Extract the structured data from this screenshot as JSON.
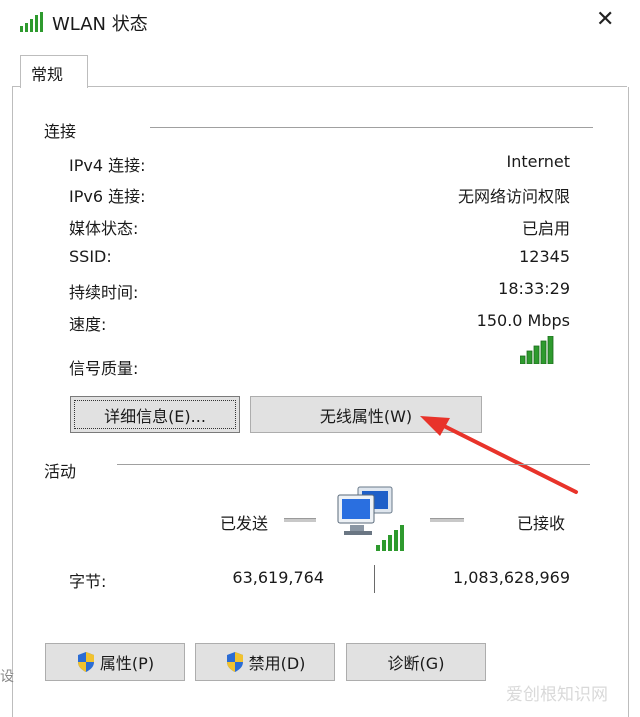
{
  "window": {
    "title": "WLAN 状态",
    "close_glyph": "✕"
  },
  "tabs": [
    {
      "label": "常规"
    }
  ],
  "connection": {
    "section_title": "连接",
    "rows": [
      {
        "label": "IPv4 连接:",
        "value": "Internet"
      },
      {
        "label": "IPv6 连接:",
        "value": "无网络访问权限"
      },
      {
        "label": "媒体状态:",
        "value": "已启用"
      },
      {
        "label": "SSID:",
        "value": "12345"
      },
      {
        "label": "持续时间:",
        "value": "18:33:29"
      },
      {
        "label": "速度:",
        "value": "150.0 Mbps"
      }
    ],
    "signal_label": "信号质量:",
    "signal_bars": 5,
    "signal_color": "#2e9a2e",
    "details_button": "详细信息(E)...",
    "wireless_props_button": "无线属性(W)"
  },
  "activity": {
    "section_title": "活动",
    "sent_label": "已发送",
    "received_label": "已接收",
    "bytes_label": "字节:",
    "bytes_sent": "63,619,764",
    "bytes_received": "1,083,628,969"
  },
  "bottom_buttons": {
    "properties": "属性(P)",
    "disable": "禁用(D)",
    "diagnose": "诊断(G)"
  },
  "annotation": {
    "arrow_color": "#e8332a"
  },
  "watermark": "爱创根知识网",
  "edge_text": "设"
}
